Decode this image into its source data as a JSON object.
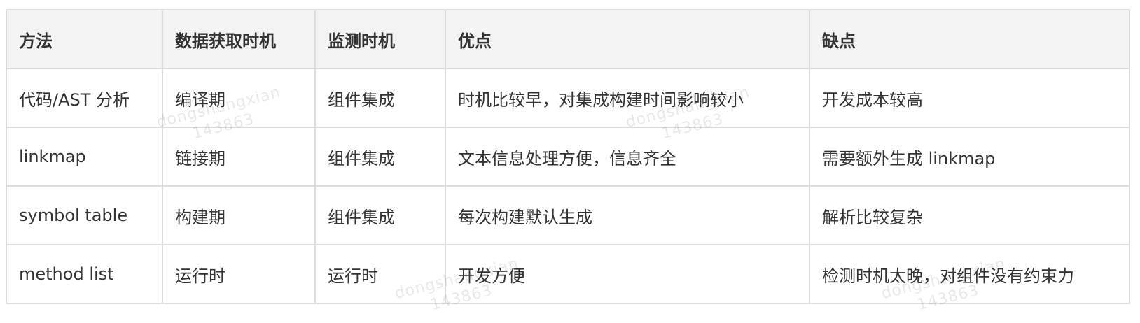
{
  "table": {
    "headers": [
      "方法",
      "数据获取时机",
      "监测时机",
      "优点",
      "缺点"
    ],
    "rows": [
      [
        "代码/AST 分析",
        "编译期",
        "组件集成",
        "时机比较早，对集成构建时间影响较小",
        "开发成本较高"
      ],
      [
        "linkmap",
        "链接期",
        "组件集成",
        "文本信息处理方便，信息齐全",
        "需要额外生成 linkmap"
      ],
      [
        "symbol table",
        "构建期",
        "组件集成",
        "每次构建默认生成",
        "解析比较复杂"
      ],
      [
        "method list",
        "运行时",
        "运行时",
        "开发方便",
        "检测时机太晚，对组件没有约束力"
      ]
    ]
  },
  "watermark": {
    "name": "dongshangxian",
    "id": "143863"
  }
}
